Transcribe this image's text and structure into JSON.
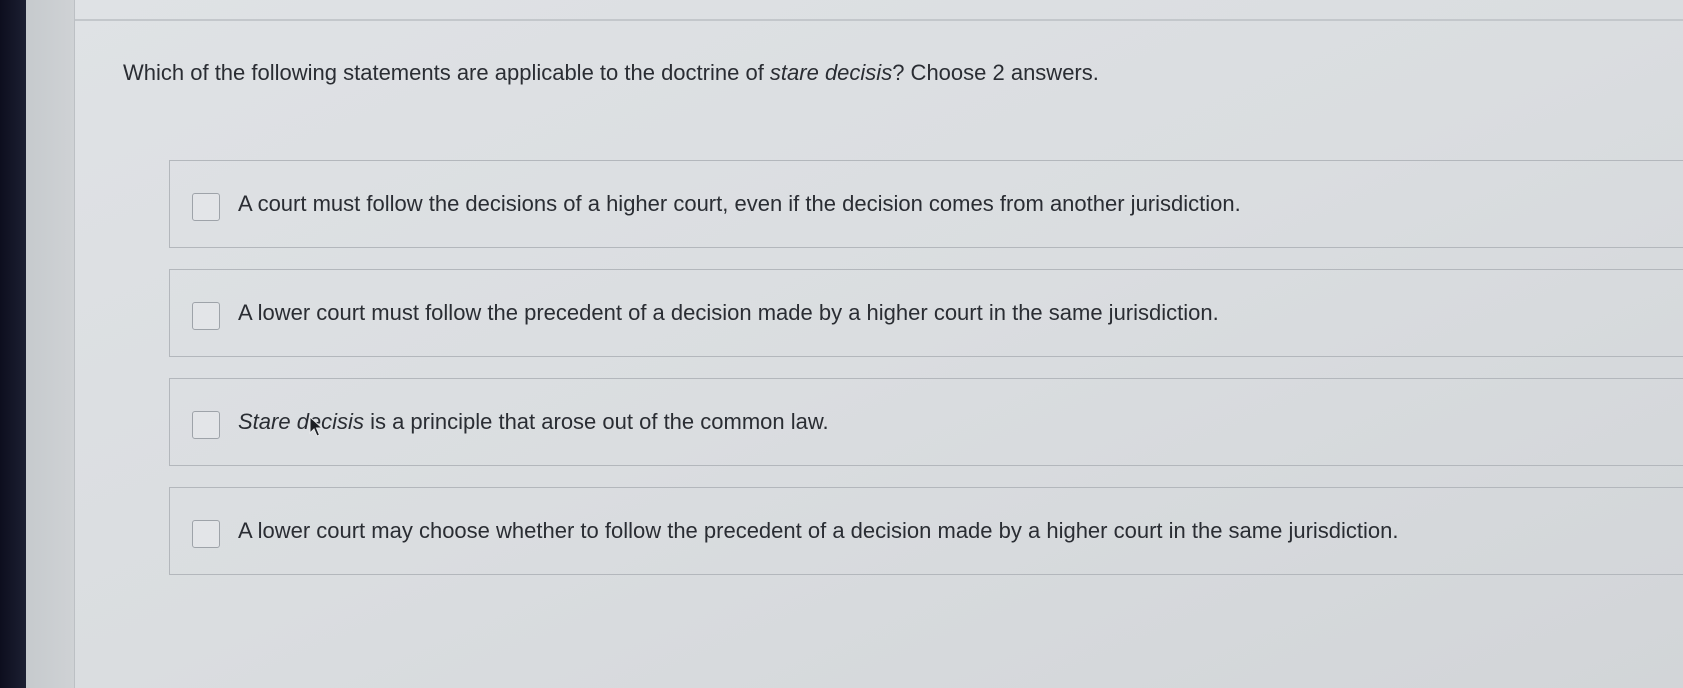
{
  "question": {
    "lead": "Which of the following statements are applicable to the doctrine of ",
    "term": "stare decisis",
    "tail": "? Choose 2 answers."
  },
  "options": [
    {
      "italic_prefix": "",
      "text": "A court must follow the decisions of a higher court, even if the decision comes from another jurisdiction.",
      "checked": false
    },
    {
      "italic_prefix": "",
      "text": "A lower court must follow the precedent of a decision made by a higher court in the same jurisdiction.",
      "checked": false
    },
    {
      "italic_prefix": "Stare decisis",
      "text": " is a principle that arose out of the common law.",
      "checked": false
    },
    {
      "italic_prefix": "",
      "text": "A lower court may choose whether to follow the precedent of a decision made by a higher court in the same jurisdiction.",
      "checked": false
    }
  ],
  "icons": {
    "checkbox": "empty-checkbox-icon",
    "cursor": "mouse-pointer-icon"
  },
  "colors": {
    "text": "#2a2d33",
    "border": "#b3b7bc",
    "background": "#dadde0"
  }
}
